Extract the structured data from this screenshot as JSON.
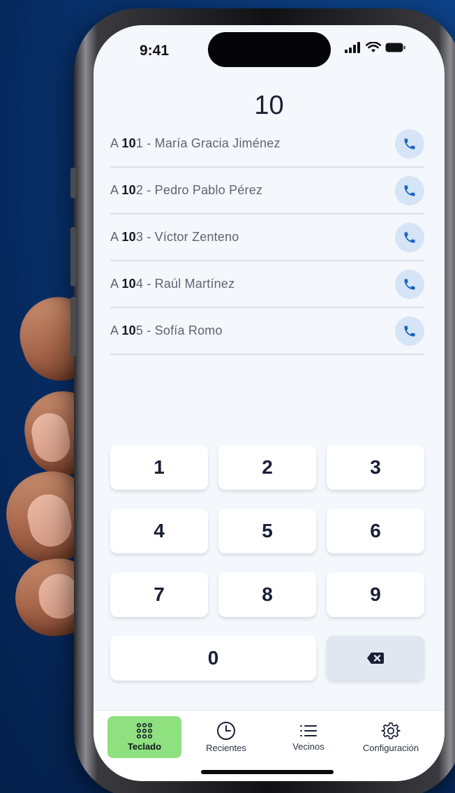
{
  "status_bar": {
    "time": "9:41"
  },
  "header": {
    "dialed": "10"
  },
  "matches": [
    {
      "prefix": "A ",
      "match": "10",
      "rest": "1 - María Gracia Jiménez"
    },
    {
      "prefix": "A ",
      "match": "10",
      "rest": "2 - Pedro Pablo Pérez"
    },
    {
      "prefix": "A ",
      "match": "10",
      "rest": "3 - Víctor Zenteno"
    },
    {
      "prefix": "A ",
      "match": "10",
      "rest": "4 - Raúl Martínez"
    },
    {
      "prefix": "A ",
      "match": "10",
      "rest": "5 - Sofía Romo"
    }
  ],
  "keypad": {
    "k1": "1",
    "k2": "2",
    "k3": "3",
    "k4": "4",
    "k5": "5",
    "k6": "6",
    "k7": "7",
    "k8": "8",
    "k9": "9",
    "k0": "0"
  },
  "tabs": {
    "keypad": "Teclado",
    "recents": "Recientes",
    "neighbors": "Vecinos",
    "settings": "Configuración"
  },
  "colors": {
    "active_tab": "#8fe07e",
    "call_button_bg": "#d6e4f7",
    "call_icon": "#1565c0",
    "background": "#0a3a7c"
  },
  "icons": {
    "call": "phone-icon",
    "delete": "backspace-icon",
    "keypad_tab": "dialpad-icon",
    "recents_tab": "clock-icon",
    "neighbors_tab": "list-icon",
    "settings_tab": "gear-icon"
  }
}
